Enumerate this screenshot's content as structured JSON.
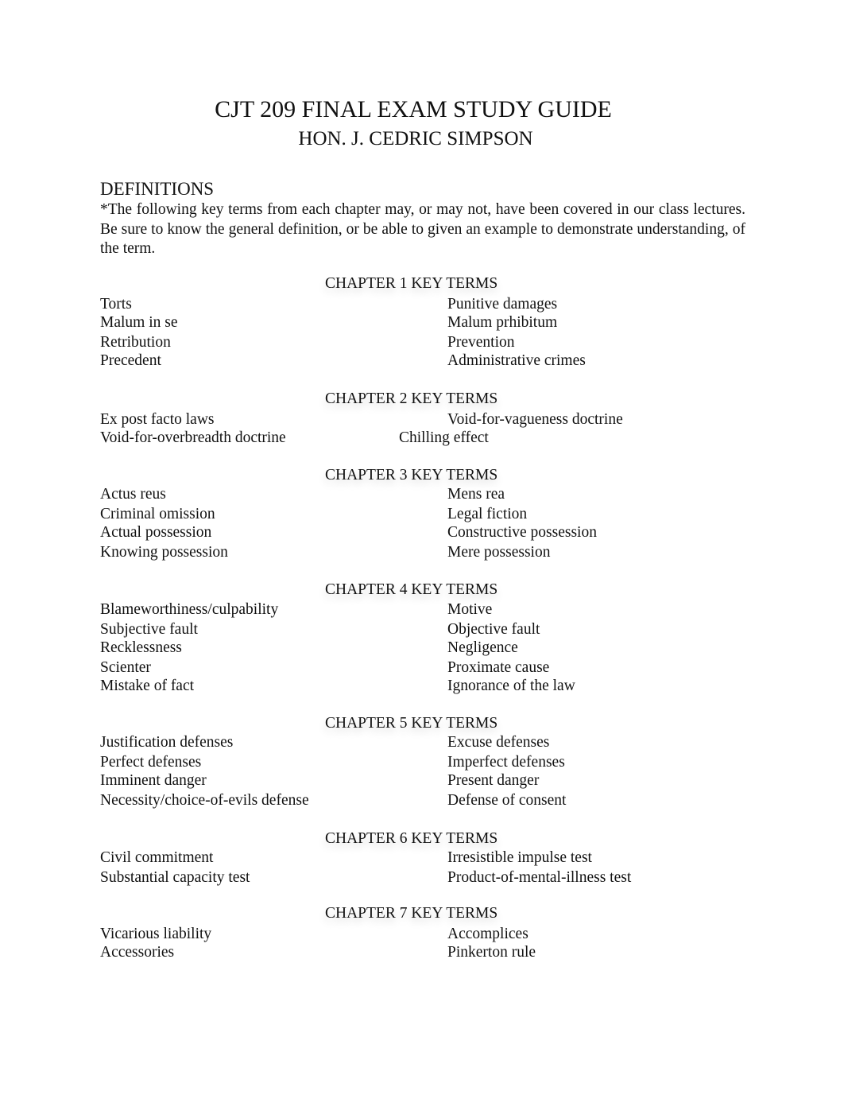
{
  "header": {
    "title": "CJT 209 FINAL EXAM STUDY GUIDE",
    "subtitle": "HON. J. CEDRIC SIMPSON"
  },
  "definitions": {
    "heading": "DEFINITIONS",
    "intro": "*The following key terms from each chapter may, or may not, have been covered in our class lectures. Be sure to know the general definition, or be able to given an example to demonstrate understanding, of the term."
  },
  "chapters": [
    {
      "heading": "CHAPTER 1 KEY TERMS",
      "rows": [
        [
          "Torts",
          "Punitive damages"
        ],
        [
          "Malum in se",
          "Malum prhibitum"
        ],
        [
          "Retribution",
          "Prevention"
        ],
        [
          "Precedent",
          "Administrative crimes"
        ]
      ]
    },
    {
      "heading": "CHAPTER 2 KEY TERMS",
      "rows": [
        [
          "Ex post facto laws",
          "Void-for-vagueness doctrine"
        ],
        [
          "Void-for-overbreadth doctrine",
          "Chilling effect"
        ]
      ]
    },
    {
      "heading": "CHAPTER 3 KEY TERMS",
      "rows": [
        [
          "Actus reus",
          "Mens rea"
        ],
        [
          "Criminal omission",
          "Legal fiction"
        ],
        [
          "Actual possession",
          "Constructive possession"
        ],
        [
          "Knowing possession",
          "Mere possession"
        ]
      ]
    },
    {
      "heading": "CHAPTER 4 KEY TERMS",
      "rows": [
        [
          "Blameworthiness/culpability",
          "Motive"
        ],
        [
          "Subjective fault",
          "Objective fault"
        ],
        [
          "Recklessness",
          "Negligence"
        ],
        [
          "Scienter",
          "Proximate cause"
        ],
        [
          "Mistake of fact",
          "Ignorance of the law"
        ]
      ]
    },
    {
      "heading": "CHAPTER 5 KEY TERMS",
      "rows": [
        [
          "Justification defenses",
          "Excuse defenses"
        ],
        [
          "Perfect defenses",
          "Imperfect defenses"
        ],
        [
          "Imminent danger",
          "Present danger"
        ],
        [
          "Necessity/choice-of-evils defense",
          "Defense of consent"
        ]
      ]
    },
    {
      "heading": "CHAPTER 6 KEY TERMS",
      "rows": [
        [
          "Civil commitment",
          "Irresistible impulse test"
        ],
        [
          "Substantial capacity test",
          "Product-of-mental-illness test"
        ]
      ]
    },
    {
      "heading": "CHAPTER 7 KEY TERMS",
      "rows": [
        [
          "Vicarious liability",
          "Accomplices"
        ],
        [
          "Accessories",
          "Pinkerton rule"
        ]
      ]
    }
  ]
}
